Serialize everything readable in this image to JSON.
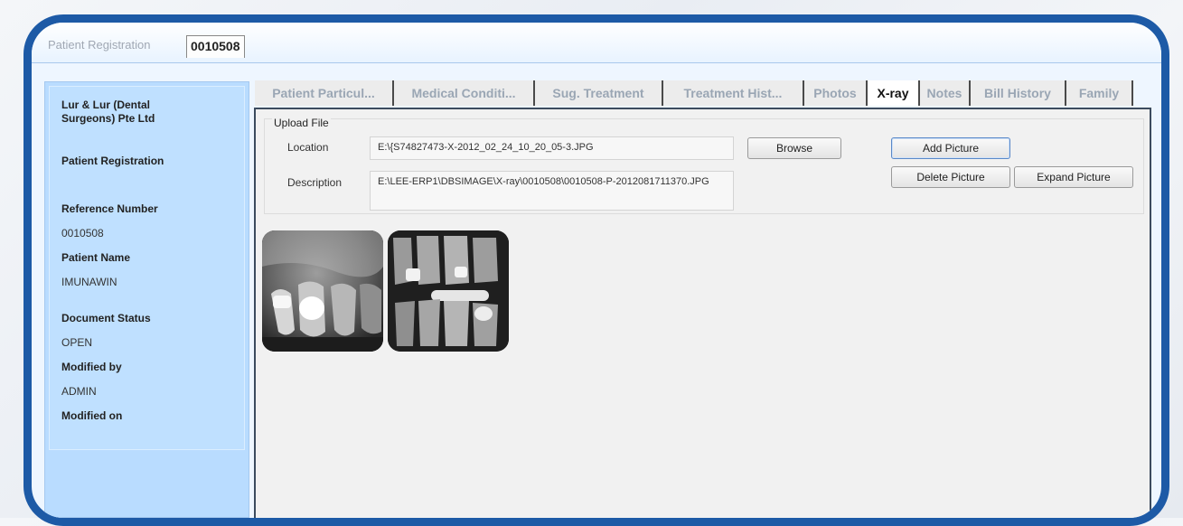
{
  "doc_tabs": {
    "inactive_label": "Patient Registration",
    "active_label": "0010508"
  },
  "sidebar": {
    "company": "Lur & Lur (Dental Surgeons) Pte Ltd",
    "section": "Patient Registration",
    "fields": [
      {
        "label": "Reference Number",
        "value": "0010508"
      },
      {
        "label": "Patient Name",
        "value": "IMUNAWIN"
      },
      {
        "label": "Document Status",
        "value": "OPEN"
      },
      {
        "label": "Modified by",
        "value": "ADMIN"
      },
      {
        "label": "Modified on",
        "value": ""
      }
    ]
  },
  "tabs": [
    {
      "label": "Patient Particul...",
      "active": false
    },
    {
      "label": "Medical Conditi...",
      "active": false
    },
    {
      "label": "Sug. Treatment",
      "active": false
    },
    {
      "label": "Treatment Hist...",
      "active": false
    },
    {
      "label": "Photos",
      "active": false
    },
    {
      "label": "X-ray",
      "active": true
    },
    {
      "label": "Notes",
      "active": false
    },
    {
      "label": "Bill History",
      "active": false
    },
    {
      "label": "Family",
      "active": false
    }
  ],
  "upload": {
    "title": "Upload File",
    "location_label": "Location",
    "location_value": "E:\\{S74827473-X-2012_02_24_10_20_05-3.JPG",
    "description_label": "Description",
    "description_value": "E:\\LEE-ERP1\\DBSIMAGE\\X-ray\\0010508\\0010508-P-2012081711370.JPG",
    "browse_label": "Browse",
    "add_label": "Add Picture",
    "delete_label": "Delete Picture",
    "expand_label": "Expand Picture"
  },
  "thumbnails": [
    {
      "name": "xray-thumbnail-1"
    },
    {
      "name": "xray-thumbnail-2"
    }
  ],
  "colors": {
    "frame": "#1d5aa6",
    "sidebar": "#b9dcff",
    "content_bg": "#f1f1f1"
  }
}
